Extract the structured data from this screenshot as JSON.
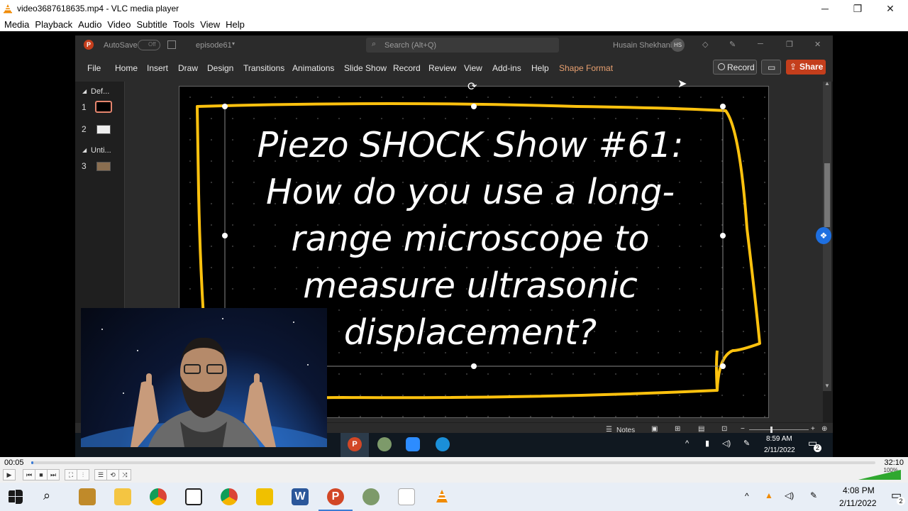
{
  "window": {
    "title": "video3687618635.mp4 - VLC media player"
  },
  "vlc_menu": [
    "Media",
    "Playback",
    "Audio",
    "Video",
    "Subtitle",
    "Tools",
    "View",
    "Help"
  ],
  "ppt": {
    "autosave": "AutoSave",
    "autosave_state": "Off",
    "filename": "episode61",
    "search_placeholder": "Search (Alt+Q)",
    "user_name": "Husain Shekhani",
    "user_initials": "HS",
    "tabs": [
      "File",
      "Home",
      "Insert",
      "Draw",
      "Design",
      "Transitions",
      "Animations",
      "Slide Show",
      "Record",
      "Review",
      "View",
      "Add-ins",
      "Help",
      "Shape Format"
    ],
    "record_label": "Record",
    "share_label": "Share",
    "sections": [
      {
        "name": "Def...",
        "slides": [
          "1",
          "2"
        ]
      },
      {
        "name": "Unti...",
        "slides": [
          "3"
        ]
      }
    ],
    "slide_title": "Piezo SHOCK Show #61: How do you use a long-range microscope to measure ultrasonic displacement?",
    "notes_label": "Notes",
    "inner_clock_time": "8:59 AM",
    "inner_clock_date": "2/11/2022",
    "inner_notification_count": "2"
  },
  "vlc": {
    "time_elapsed": "00:05",
    "time_total": "32:10",
    "progress_fraction": 0.0026,
    "volume_label": "100%",
    "volume_fraction": 1.0
  },
  "taskbar": {
    "clock_time": "4:08 PM",
    "clock_date": "2/11/2022",
    "notification_count": "2"
  },
  "colors": {
    "accent": "#3a7bd5",
    "ppt_accent": "#c43e1c",
    "slide_frame": "#ffc20e"
  }
}
